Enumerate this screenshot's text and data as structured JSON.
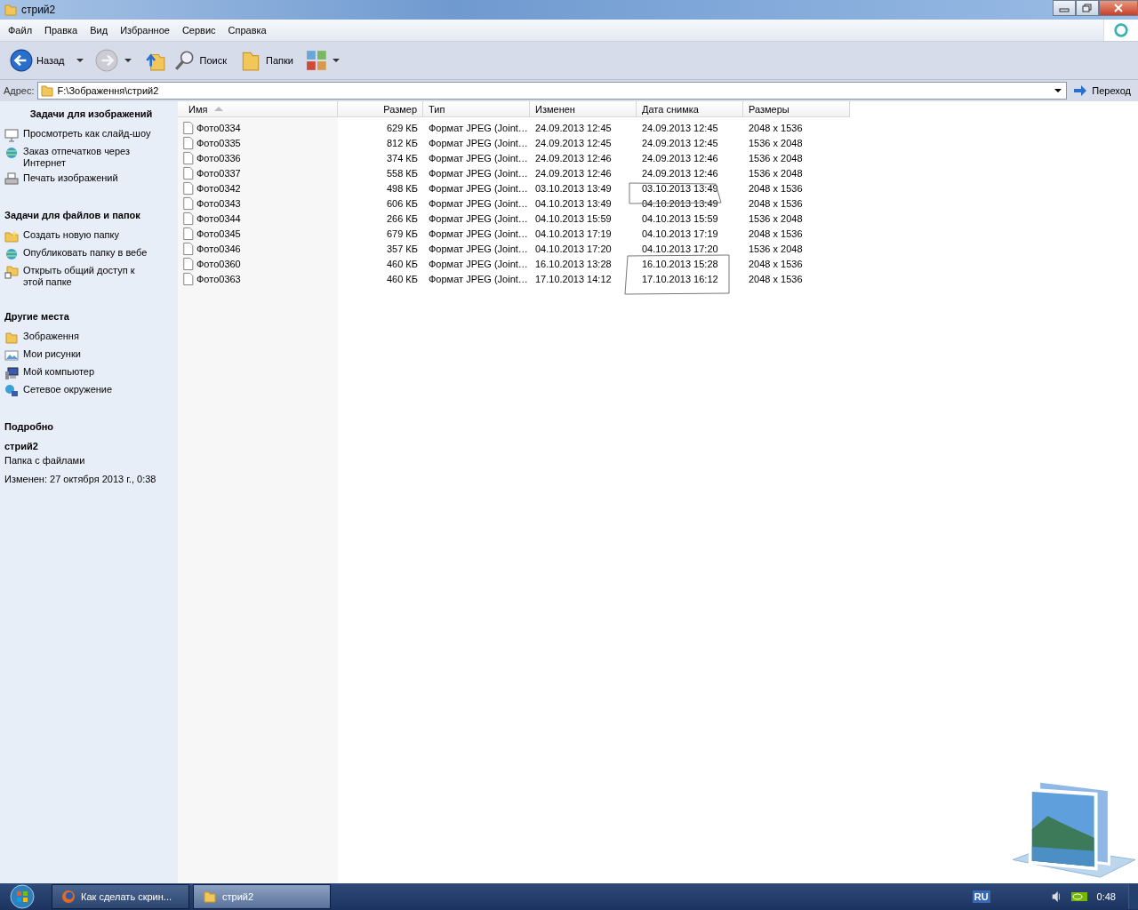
{
  "window": {
    "title": "стрий2"
  },
  "menu": [
    "Файл",
    "Правка",
    "Вид",
    "Избранное",
    "Сервис",
    "Справка"
  ],
  "toolbar": [
    {
      "kind": "back",
      "label": "Назад",
      "disabled": false
    },
    {
      "kind": "forward",
      "disabled": true
    },
    {
      "kind": "up"
    },
    {
      "kind": "search",
      "label": "Поиск"
    },
    {
      "kind": "folders",
      "label": "Папки"
    },
    {
      "kind": "views"
    }
  ],
  "address": {
    "label": "Адрес:",
    "value": "F:\\Зображення\\стрий2",
    "go": "Переход"
  },
  "sidebar": {
    "sections": [
      {
        "title": "Задачи для изображений",
        "items": [
          {
            "kind": "slideshow",
            "label": "Просмотреть как слайд-шоу"
          },
          {
            "kind": "globe",
            "label": "Заказ отпечатков через Интернет"
          },
          {
            "kind": "printer",
            "label": "Печать изображений"
          }
        ]
      },
      {
        "title": "Задачи для файлов и папок",
        "items": [
          {
            "kind": "newfolder",
            "label": "Создать новую папку"
          },
          {
            "kind": "globe",
            "label": "Опубликовать папку в вебе"
          },
          {
            "kind": "share",
            "label": "Открыть общий доступ к этой папке"
          }
        ]
      },
      {
        "title": "Другие места",
        "items": [
          {
            "kind": "folder",
            "label": "Зображення"
          },
          {
            "kind": "pictures",
            "label": "Мои рисунки"
          },
          {
            "kind": "computer",
            "label": "Мой компьютер"
          },
          {
            "kind": "network",
            "label": "Сетевое окружение"
          }
        ]
      }
    ],
    "details": {
      "title": "Подробно",
      "name": "стрий2",
      "type": "Папка с файлами",
      "modified": "Изменен: 27 октября 2013 г., 0:38"
    }
  },
  "table": {
    "columns": [
      {
        "label": "Имя",
        "sorted": true
      },
      {
        "label": "Размер",
        "sorted": false
      },
      {
        "label": "Тип",
        "sorted": false
      },
      {
        "label": "Изменен",
        "sorted": false
      },
      {
        "label": "Дата снимка",
        "sorted": false
      },
      {
        "label": "Размеры",
        "sorted": false
      }
    ],
    "rows": [
      [
        "Фото0334",
        "629 КБ",
        "Формат JPEG (Joint…",
        "24.09.2013 12:45",
        "24.09.2013 12:45",
        "2048 x 1536"
      ],
      [
        "Фото0335",
        "812 КБ",
        "Формат JPEG (Joint…",
        "24.09.2013 12:45",
        "24.09.2013 12:45",
        "1536 x 2048"
      ],
      [
        "Фото0336",
        "374 КБ",
        "Формат JPEG (Joint…",
        "24.09.2013 12:46",
        "24.09.2013 12:46",
        "1536 x 2048"
      ],
      [
        "Фото0337",
        "558 КБ",
        "Формат JPEG (Joint…",
        "24.09.2013 12:46",
        "24.09.2013 12:46",
        "1536 x 2048"
      ],
      [
        "Фото0342",
        "498 КБ",
        "Формат JPEG (Joint…",
        "03.10.2013 13:49",
        "03.10.2013 13:49",
        "2048 x 1536"
      ],
      [
        "Фото0343",
        "606 КБ",
        "Формат JPEG (Joint…",
        "04.10.2013 13:49",
        "04.10.2013 13:49",
        "2048 x 1536"
      ],
      [
        "Фото0344",
        "266 КБ",
        "Формат JPEG (Joint…",
        "04.10.2013 15:59",
        "04.10.2013 15:59",
        "1536 x 2048"
      ],
      [
        "Фото0345",
        "679 КБ",
        "Формат JPEG (Joint…",
        "04.10.2013 17:19",
        "04.10.2013 17:19",
        "2048 x 1536"
      ],
      [
        "Фото0346",
        "357 КБ",
        "Формат JPEG (Joint…",
        "04.10.2013 17:20",
        "04.10.2013 17:20",
        "1536 x 2048"
      ],
      [
        "Фото0360",
        "460 КБ",
        "Формат JPEG (Joint…",
        "16.10.2013 13:28",
        "16.10.2013 15:28",
        "2048 x 1536"
      ],
      [
        "Фото0363",
        "460 КБ",
        "Формат JPEG (Joint…",
        "17.10.2013 14:12",
        "17.10.2013 16:12",
        "2048 x 1536"
      ]
    ]
  },
  "taskbar": {
    "tasks": [
      {
        "kind": "browser",
        "label": "Как сделать скрин...",
        "selected": false
      },
      {
        "kind": "folder",
        "label": "стрий2",
        "selected": true
      }
    ],
    "language": "RU",
    "clock": "0:48"
  }
}
